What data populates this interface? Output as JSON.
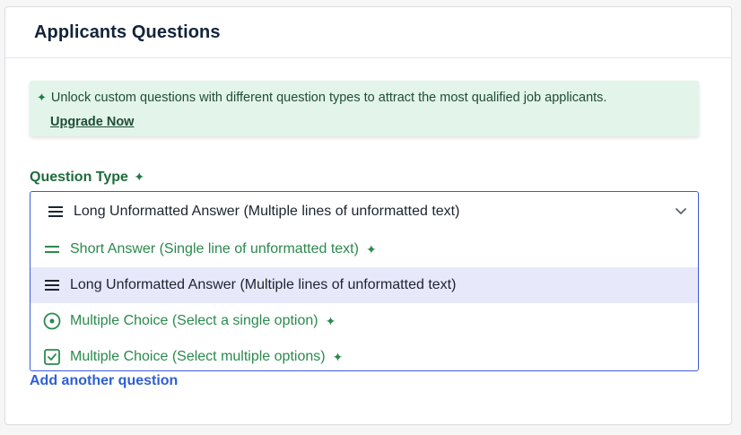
{
  "card": {
    "title": "Applicants Questions"
  },
  "banner": {
    "text": "Unlock custom questions with different question types to attract the most qualified job applicants.",
    "upgrade_label": "Upgrade Now"
  },
  "question_type": {
    "label": "Question Type",
    "selected": "Long Unformatted Answer (Multiple lines of unformatted text)",
    "options": [
      {
        "label": "Short Answer (Single line of unformatted text)",
        "icon": "short-lines-icon",
        "premium": true
      },
      {
        "label": "Long Unformatted Answer (Multiple lines of unformatted text)",
        "icon": "long-lines-icon",
        "premium": false
      },
      {
        "label": "Multiple Choice (Select a single option)",
        "icon": "radio-icon",
        "premium": true
      },
      {
        "label": "Multiple Choice (Select multiple options)",
        "icon": "checkbox-icon",
        "premium": true
      }
    ]
  },
  "add_question_label": "Add another question",
  "colors": {
    "accent_green": "#2a8a4d",
    "banner_bg": "#e3f4ea",
    "link_blue": "#2d5fd4",
    "selected_bg": "#e8e8fb",
    "dropdown_border": "#3b5bdb"
  }
}
